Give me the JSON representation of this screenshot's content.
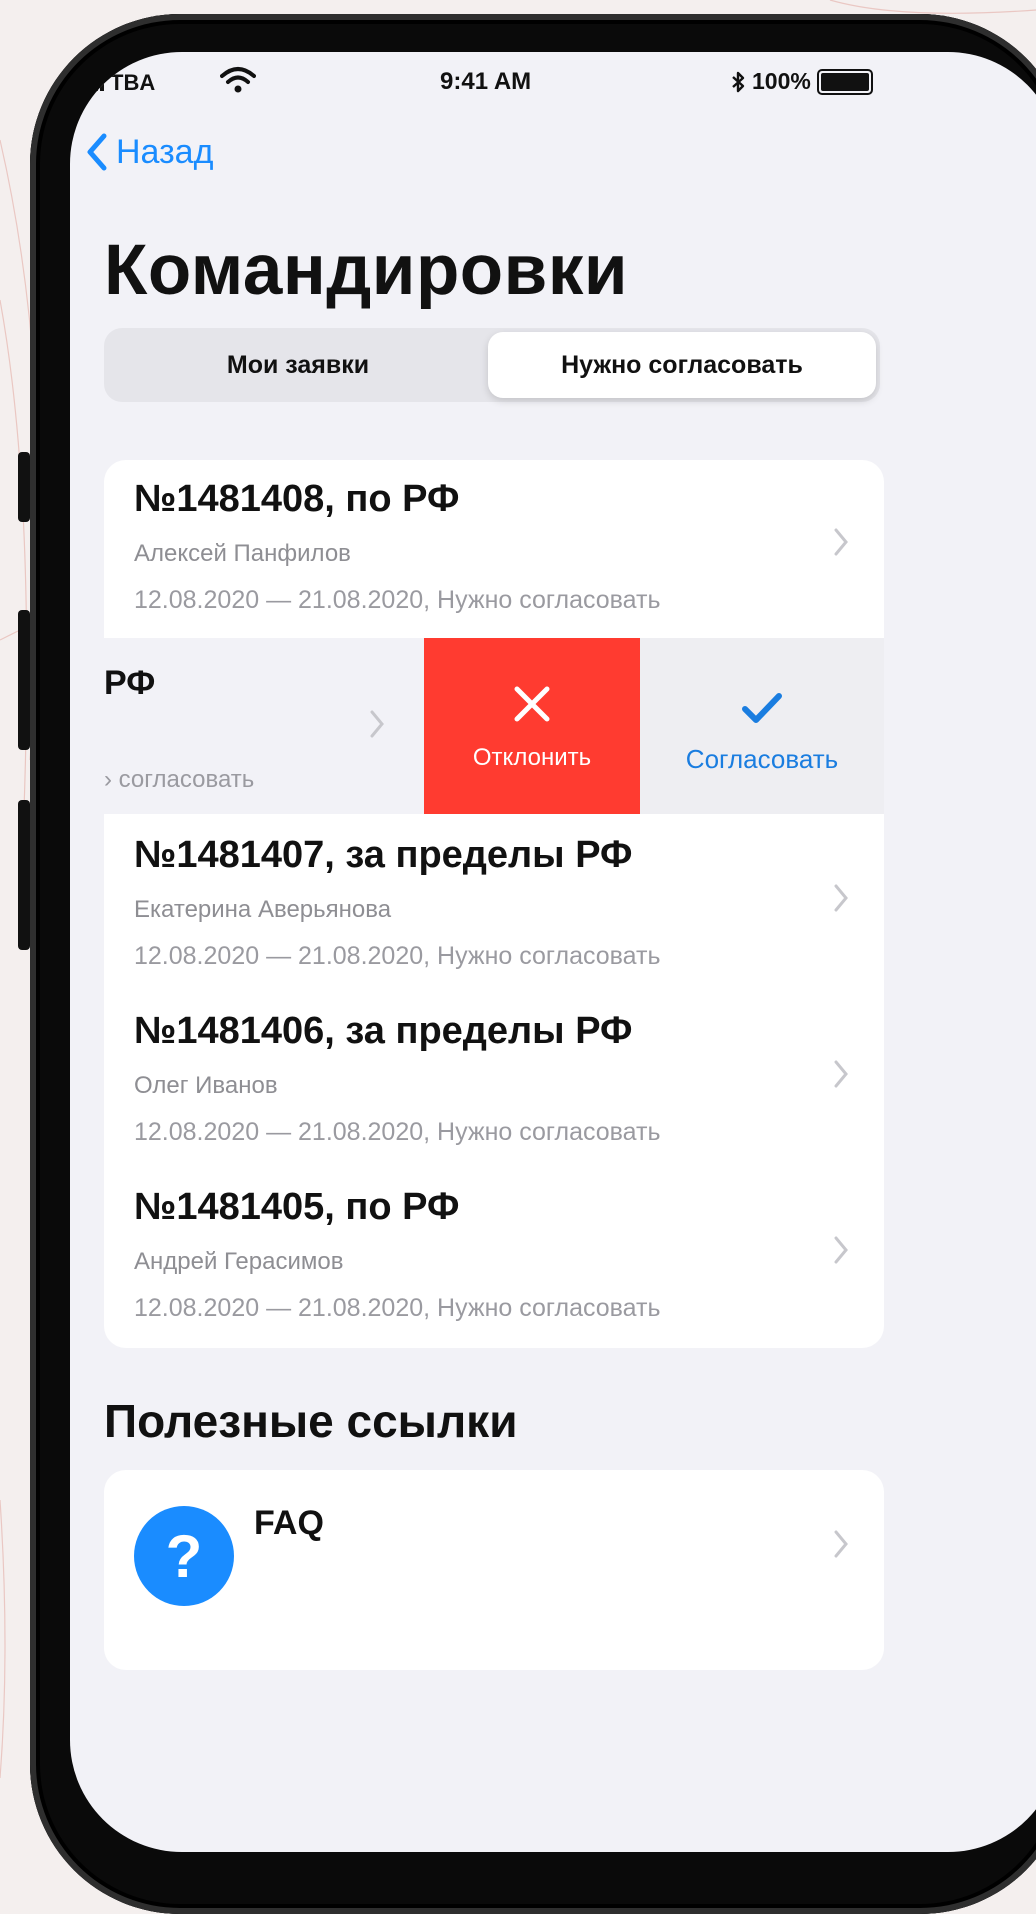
{
  "status_bar": {
    "carrier": "TBA",
    "time": "9:41 AM",
    "battery": "100%"
  },
  "nav": {
    "back_label": "Назад",
    "title": "Командировки"
  },
  "segments": {
    "mine": "Мои заявки",
    "to_approve": "Нужно согласовать",
    "selected": "to_approve"
  },
  "requests": [
    {
      "number": "№1481408, по РФ",
      "person": "Алексей Панфилов",
      "dates": "12.08.2020 — 21.08.2020, Нужно согласовать"
    },
    {
      "number": "РФ",
      "dates": "› согласовать"
    },
    {
      "number": "№1481407, за пределы РФ",
      "person": "Екатерина Аверьянова",
      "dates": "12.08.2020 — 21.08.2020, Нужно согласовать"
    },
    {
      "number": "№1481406, за пределы РФ",
      "person": "Олег Иванов",
      "dates": "12.08.2020 — 21.08.2020, Нужно согласовать"
    },
    {
      "number": "№1481405, по РФ",
      "person": "Андрей Герасимов",
      "dates": "12.08.2020 — 21.08.2020, Нужно согласовать"
    }
  ],
  "swipe_actions": {
    "reject": "Отклонить",
    "approve": "Согласовать"
  },
  "links_section": {
    "title": "Полезные ссылки",
    "items": [
      {
        "icon": "question-icon",
        "icon_glyph": "?",
        "label": "FAQ"
      }
    ]
  },
  "colors": {
    "accent": "#1a8cff",
    "reject": "#ff3b30",
    "background": "#f2f2f7"
  }
}
